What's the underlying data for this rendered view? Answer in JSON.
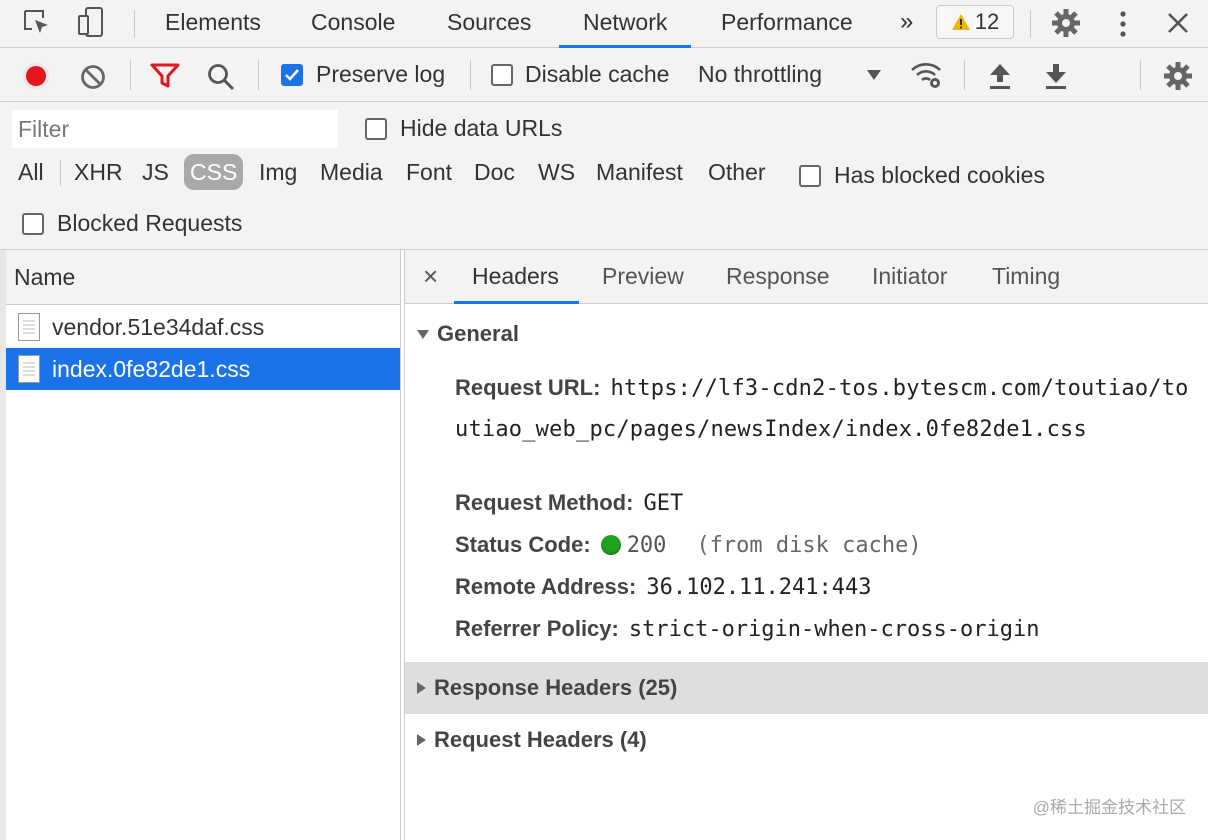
{
  "devtools": {
    "tabs": [
      "Elements",
      "Console",
      "Sources",
      "Network",
      "Performance"
    ],
    "active_tab": "Network",
    "more_tabs": "»",
    "warning_count": "12"
  },
  "toolbar": {
    "preserve_log": "Preserve log",
    "preserve_log_checked": true,
    "disable_cache": "Disable cache",
    "disable_cache_checked": false,
    "throttling": "No throttling"
  },
  "filter": {
    "placeholder": "Filter",
    "hide_data_urls": "Hide data URLs",
    "types": [
      "All",
      "XHR",
      "JS",
      "CSS",
      "Img",
      "Media",
      "Font",
      "Doc",
      "WS",
      "Manifest",
      "Other"
    ],
    "active_type": "CSS",
    "has_blocked_cookies": "Has blocked cookies",
    "blocked_requests": "Blocked Requests"
  },
  "requests": {
    "column": "Name",
    "items": [
      {
        "name": "vendor.51e34daf.css",
        "selected": false
      },
      {
        "name": "index.0fe82de1.css",
        "selected": true
      }
    ]
  },
  "details": {
    "close": "×",
    "tabs": [
      "Headers",
      "Preview",
      "Response",
      "Initiator",
      "Timing"
    ],
    "active_tab": "Headers",
    "general": {
      "title": "General",
      "request_url_label": "Request URL:",
      "request_url": "https://lf3-cdn2-tos.bytescm.com/toutiao/toutiao_web_pc/pages/newsIndex/index.0fe82de1.css",
      "request_method_label": "Request Method:",
      "request_method": "GET",
      "status_code_label": "Status Code:",
      "status_code": "200",
      "status_note": "(from disk cache)",
      "remote_address_label": "Remote Address:",
      "remote_address": "36.102.11.241:443",
      "referrer_policy_label": "Referrer Policy:",
      "referrer_policy": "strict-origin-when-cross-origin"
    },
    "response_headers": "Response Headers (25)",
    "request_headers": "Request Headers (4)"
  },
  "watermark": "@稀土掘金技术社区"
}
